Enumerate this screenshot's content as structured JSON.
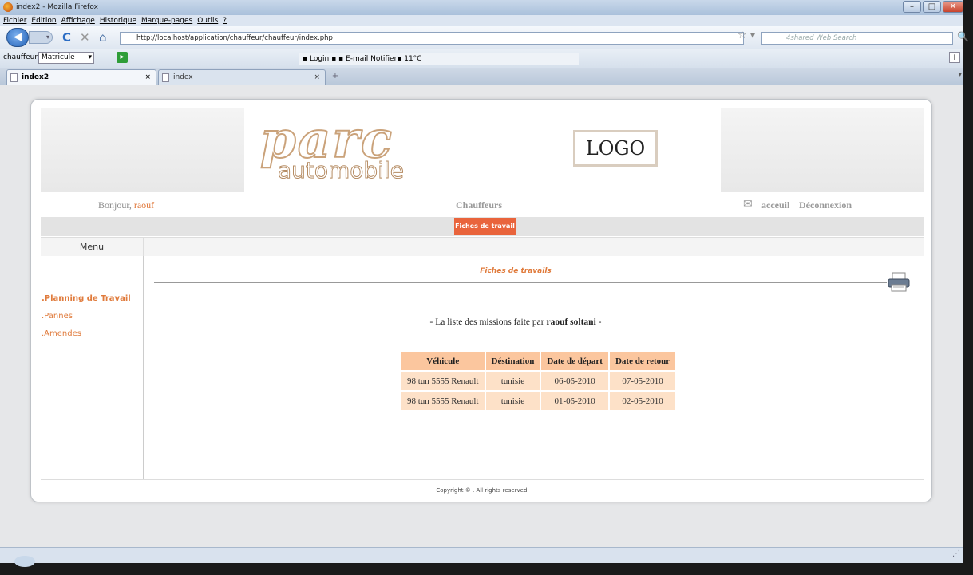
{
  "window": {
    "title": "index2 - Mozilla Firefox",
    "min": "–",
    "max": "□",
    "close": "✕"
  },
  "menubar": [
    "Fichier",
    "Édition",
    "Affichage",
    "Historique",
    "Marque-pages",
    "Outils",
    "?"
  ],
  "nav": {
    "back": "◀",
    "forward": "▾",
    "reload": "C",
    "stop": "✕",
    "home": "⌂",
    "url": "http://localhost/application/chauffeur/chauffeur/index.php",
    "star": "☆ ▾",
    "search_placeholder": "4shared Web Search",
    "search_icon": "🔍"
  },
  "toolbar2": {
    "label": "chauffeur :",
    "select": "Matricule",
    "green": "▸",
    "mid": "▪ Login ▪        ▪   E-mail Notifier▪  11°C",
    "plus": "+"
  },
  "tabs": [
    {
      "label": "index2",
      "close": "×",
      "active": true
    },
    {
      "label": "index",
      "close": "×",
      "active": false
    }
  ],
  "newtab": "+",
  "site": {
    "logo_main": "parc",
    "logo_sub": "automobile",
    "logo_box": "LOGO",
    "greeting": "Bonjour,",
    "username": "raouf",
    "section": "Chauffeurs",
    "mail_icon": "✉",
    "home_link": "acceuil",
    "logout_link": "Déconnexion",
    "active_tab": "Fiches de travail",
    "menu_label": "Menu",
    "sidebar": [
      ".Planning de Travail",
      ".Pannes",
      ".Amendes"
    ],
    "page_title": "Fiches de travails",
    "list_intro": "- La liste des missions faite par",
    "list_name": "raouf  soltani",
    "list_end": "-",
    "footer": "Copyright © . All rights reserved."
  },
  "table": {
    "headers": [
      "Véhicule",
      "Déstination",
      "Date de départ",
      "Date de retour"
    ],
    "rows": [
      [
        "98 tun 5555 Renault",
        "tunisie",
        "06-05-2010",
        "07-05-2010"
      ],
      [
        "98 tun 5555 Renault",
        "tunisie",
        "01-05-2010",
        "02-05-2010"
      ]
    ]
  }
}
